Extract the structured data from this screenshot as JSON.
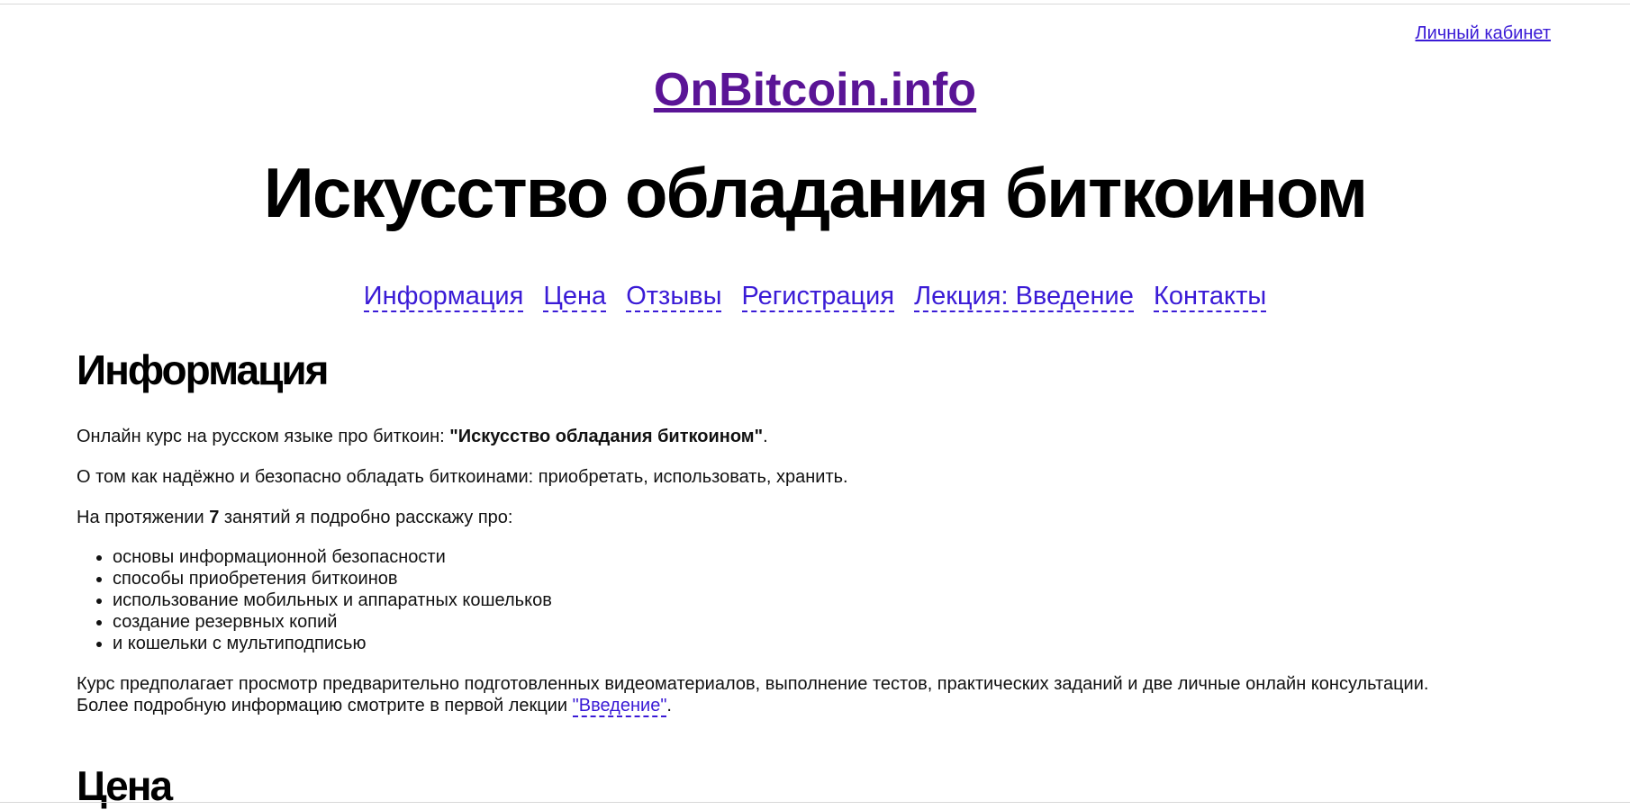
{
  "header": {
    "account_link": "Личный кабинет",
    "site_name": "OnBitcoin.info",
    "hero_title": "Искусство обладания биткоином"
  },
  "nav": {
    "items": [
      {
        "label": "Информация"
      },
      {
        "label": "Цена"
      },
      {
        "label": "Отзывы"
      },
      {
        "label": "Регистрация"
      },
      {
        "label": "Лекция: Введение"
      },
      {
        "label": "Контакты"
      }
    ]
  },
  "info": {
    "heading": "Информация",
    "p1_prefix": "Онлайн курс на русском языке про биткоин: ",
    "p1_bold": "\"Искусство обладания биткоином\"",
    "p1_suffix": ".",
    "p2": "О том как надёжно и безопасно обладать биткоинами: приобретать, использовать, хранить.",
    "p3_prefix": "На протяжении ",
    "p3_bold": "7",
    "p3_suffix": " занятий я подробно расскажу про:",
    "topics": [
      "основы информационной безопасности",
      "способы приобретения биткоинов",
      "использование мобильных и аппаратных кошельков",
      "создание резервных копий",
      "и кошельки с мультиподписью"
    ],
    "p4_line1": "Курс предполагает просмотр предварительно подготовленных видеоматериалов, выполнение тестов, практических заданий и две личные онлайн консультации.",
    "p4_line2_prefix": "Более подробную информацию смотрите в первой лекции ",
    "p4_link": "\"Введение\"",
    "p4_suffix": "."
  },
  "price": {
    "heading": "Цена"
  },
  "colors": {
    "link": "#3a1bd6",
    "visited_link": "#5a1496",
    "text": "#111111"
  }
}
